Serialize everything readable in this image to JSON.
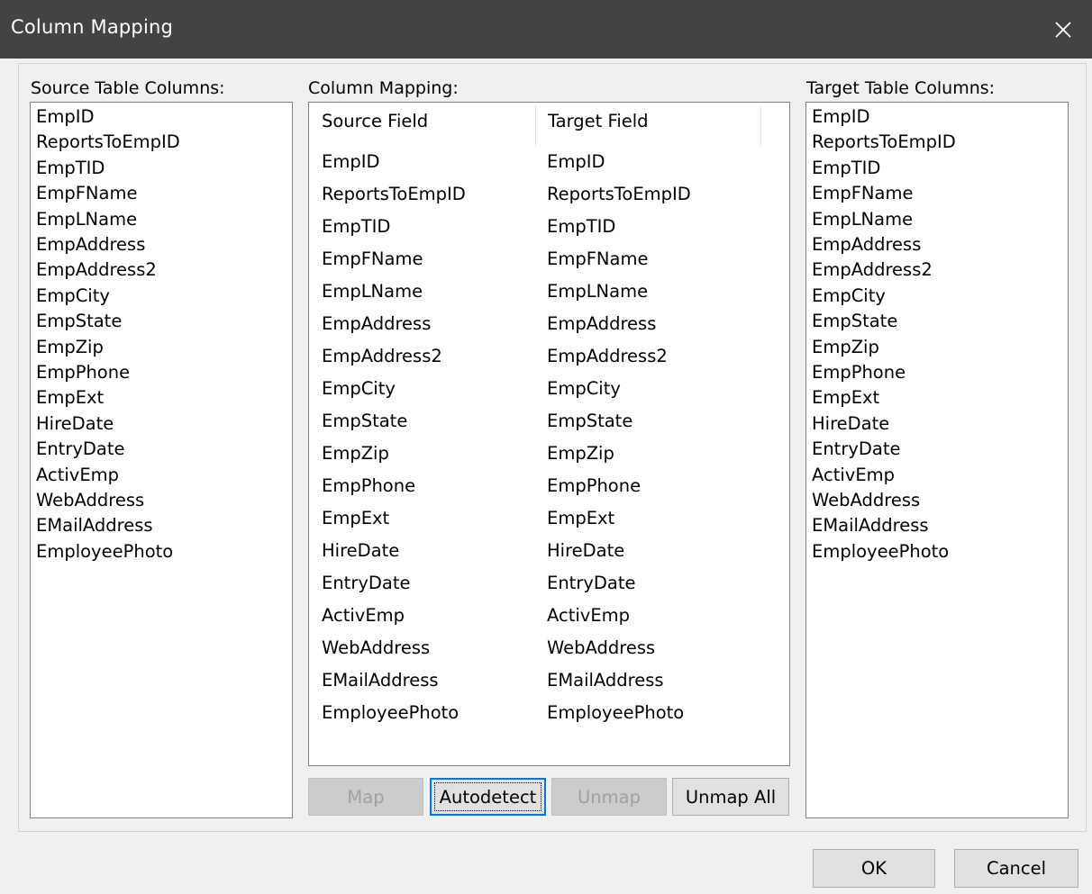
{
  "window": {
    "title": "Column Mapping",
    "close_icon": "close-icon"
  },
  "source": {
    "label": "Source Table Columns:",
    "items": [
      "EmpID",
      "ReportsToEmpID",
      "EmpTID",
      "EmpFName",
      "EmpLName",
      "EmpAddress",
      "EmpAddress2",
      "EmpCity",
      "EmpState",
      "EmpZip",
      "EmpPhone",
      "EmpExt",
      "HireDate",
      "EntryDate",
      "ActivEmp",
      "WebAddress",
      "EMailAddress",
      "EmployeePhoto"
    ]
  },
  "mapping": {
    "label": "Column Mapping:",
    "headers": {
      "source": "Source Field",
      "target": "Target Field"
    },
    "rows": [
      {
        "source": "EmpID",
        "target": "EmpID"
      },
      {
        "source": "ReportsToEmpID",
        "target": "ReportsToEmpID"
      },
      {
        "source": "EmpTID",
        "target": "EmpTID"
      },
      {
        "source": "EmpFName",
        "target": "EmpFName"
      },
      {
        "source": "EmpLName",
        "target": "EmpLName"
      },
      {
        "source": "EmpAddress",
        "target": "EmpAddress"
      },
      {
        "source": "EmpAddress2",
        "target": "EmpAddress2"
      },
      {
        "source": "EmpCity",
        "target": "EmpCity"
      },
      {
        "source": "EmpState",
        "target": "EmpState"
      },
      {
        "source": "EmpZip",
        "target": "EmpZip"
      },
      {
        "source": "EmpPhone",
        "target": "EmpPhone"
      },
      {
        "source": "EmpExt",
        "target": "EmpExt"
      },
      {
        "source": "HireDate",
        "target": "HireDate"
      },
      {
        "source": "EntryDate",
        "target": "EntryDate"
      },
      {
        "source": "ActivEmp",
        "target": "ActivEmp"
      },
      {
        "source": "WebAddress",
        "target": "WebAddress"
      },
      {
        "source": "EMailAddress",
        "target": "EMailAddress"
      },
      {
        "source": "EmployeePhoto",
        "target": "EmployeePhoto"
      }
    ],
    "buttons": {
      "map": "Map",
      "autodetect": "Autodetect",
      "unmap": "Unmap",
      "unmap_all": "Unmap All"
    }
  },
  "target": {
    "label": "Target Table Columns:",
    "items": [
      "EmpID",
      "ReportsToEmpID",
      "EmpTID",
      "EmpFName",
      "EmpLName",
      "EmpAddress",
      "EmpAddress2",
      "EmpCity",
      "EmpState",
      "EmpZip",
      "EmpPhone",
      "EmpExt",
      "HireDate",
      "EntryDate",
      "ActivEmp",
      "WebAddress",
      "EMailAddress",
      "EmployeePhoto"
    ]
  },
  "footer": {
    "ok": "OK",
    "cancel": "Cancel"
  }
}
